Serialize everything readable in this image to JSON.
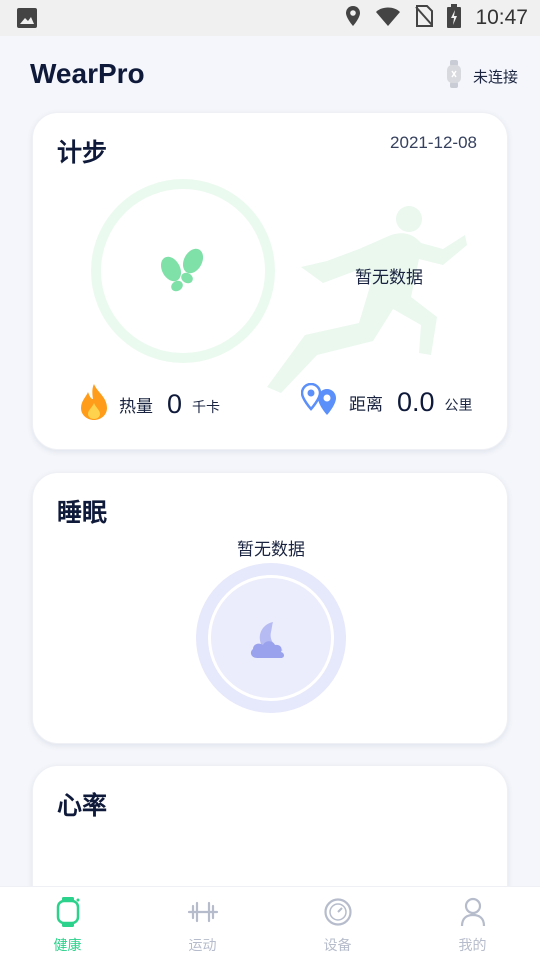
{
  "status_bar": {
    "time": "10:47",
    "icons": [
      "gallery-icon",
      "location-icon",
      "wifi-icon",
      "no-sim-icon",
      "battery-charging-icon"
    ]
  },
  "header": {
    "app_title": "WearPro",
    "connection_status": "未连接",
    "connection_icon": "watch-icon"
  },
  "steps_card": {
    "title": "计步",
    "date": "2021-12-08",
    "no_data": "暂无数据",
    "calories": {
      "label": "热量",
      "value": "0",
      "unit": "千卡",
      "icon": "flame-icon"
    },
    "distance": {
      "label": "距离",
      "value": "0.0",
      "unit": "公里",
      "icon": "location-pins-icon"
    }
  },
  "sleep_card": {
    "title": "睡眠",
    "no_data": "暂无数据",
    "icon": "moon-cloud-icon"
  },
  "heart_card": {
    "title": "心率"
  },
  "bottom_nav": {
    "items": [
      {
        "label": "健康",
        "icon": "watch-icon",
        "active": true
      },
      {
        "label": "运动",
        "icon": "dumbbell-icon",
        "active": false
      },
      {
        "label": "设备",
        "icon": "device-icon",
        "active": false
      },
      {
        "label": "我的",
        "icon": "person-icon",
        "active": false
      }
    ]
  },
  "colors": {
    "accent": "#2bd28b",
    "calorie": "#ff9d1a",
    "distance": "#5b8ff9",
    "sleep": "#9aa2ee"
  }
}
